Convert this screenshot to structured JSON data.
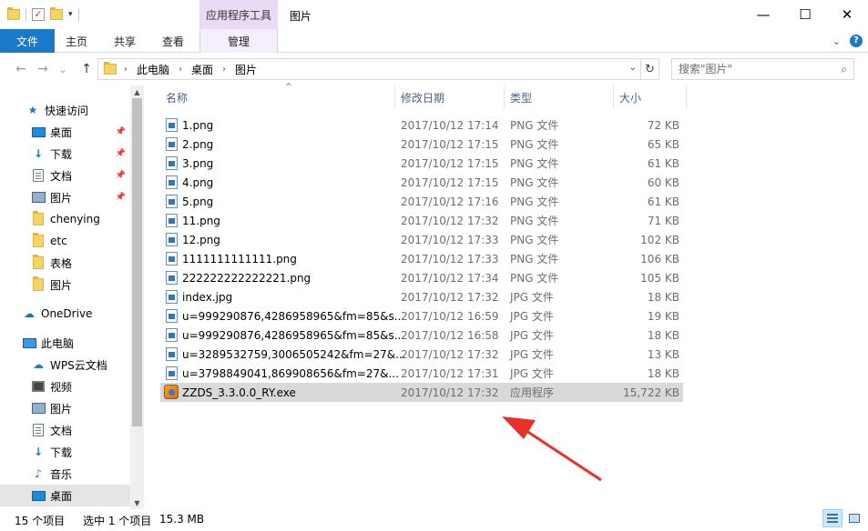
{
  "window": {
    "title": "图片",
    "context_tab_group": "应用程序工具",
    "minimize": "—",
    "maximize": "☐",
    "close": "✕"
  },
  "ribbon": {
    "tabs": [
      "文件",
      "主页",
      "共享",
      "查看",
      "管理"
    ],
    "help": "?"
  },
  "nav": {
    "back": "←",
    "forward": "→",
    "recent": "⌄",
    "up": "↑",
    "breadcrumbs": [
      "此电脑",
      "桌面",
      "图片"
    ],
    "search_placeholder": "搜索\"图片\""
  },
  "sidebar": {
    "items": [
      {
        "label": "快速访问",
        "icon": "star-icon"
      },
      {
        "label": "桌面",
        "icon": "desktop-icon",
        "pinned": true
      },
      {
        "label": "下载",
        "icon": "download-icon",
        "pinned": true
      },
      {
        "label": "文档",
        "icon": "document-icon",
        "pinned": true
      },
      {
        "label": "图片",
        "icon": "pictures-icon",
        "pinned": true
      },
      {
        "label": "chenying",
        "icon": "folder-icon"
      },
      {
        "label": "etc",
        "icon": "folder-icon"
      },
      {
        "label": "表格",
        "icon": "folder-icon"
      },
      {
        "label": "图片",
        "icon": "folder-icon"
      },
      {
        "label": "OneDrive",
        "icon": "cloud-icon"
      },
      {
        "label": "此电脑",
        "icon": "computer-icon"
      },
      {
        "label": "WPS云文档",
        "icon": "wps-cloud-icon"
      },
      {
        "label": "视频",
        "icon": "video-icon"
      },
      {
        "label": "图片",
        "icon": "pictures-icon"
      },
      {
        "label": "文档",
        "icon": "document-icon"
      },
      {
        "label": "下载",
        "icon": "download-icon"
      },
      {
        "label": "音乐",
        "icon": "music-icon"
      },
      {
        "label": "桌面",
        "icon": "desktop-icon",
        "selected": true
      }
    ]
  },
  "columns": {
    "name": "名称",
    "date": "修改日期",
    "type": "类型",
    "size": "大小"
  },
  "files": [
    {
      "name": "1.png",
      "date": "2017/10/12 17:14",
      "type": "PNG 文件",
      "size": "72 KB"
    },
    {
      "name": "2.png",
      "date": "2017/10/12 17:15",
      "type": "PNG 文件",
      "size": "65 KB"
    },
    {
      "name": "3.png",
      "date": "2017/10/12 17:15",
      "type": "PNG 文件",
      "size": "61 KB"
    },
    {
      "name": "4.png",
      "date": "2017/10/12 17:15",
      "type": "PNG 文件",
      "size": "60 KB"
    },
    {
      "name": "5.png",
      "date": "2017/10/12 17:16",
      "type": "PNG 文件",
      "size": "61 KB"
    },
    {
      "name": "11.png",
      "date": "2017/10/12 17:32",
      "type": "PNG 文件",
      "size": "71 KB"
    },
    {
      "name": "12.png",
      "date": "2017/10/12 17:33",
      "type": "PNG 文件",
      "size": "102 KB"
    },
    {
      "name": "1111111111111.png",
      "date": "2017/10/12 17:33",
      "type": "PNG 文件",
      "size": "106 KB"
    },
    {
      "name": "222222222222221.png",
      "date": "2017/10/12 17:34",
      "type": "PNG 文件",
      "size": "105 KB"
    },
    {
      "name": "index.jpg",
      "date": "2017/10/12 17:32",
      "type": "JPG 文件",
      "size": "18 KB"
    },
    {
      "name": "u=999290876,4286958965&fm=85&s...",
      "date": "2017/10/12 16:59",
      "type": "JPG 文件",
      "size": "19 KB"
    },
    {
      "name": "u=999290876,4286958965&fm=85&s...",
      "date": "2017/10/12 16:58",
      "type": "JPG 文件",
      "size": "18 KB"
    },
    {
      "name": "u=3289532759,3006505242&fm=27&...",
      "date": "2017/10/12 17:32",
      "type": "JPG 文件",
      "size": "13 KB"
    },
    {
      "name": "u=3798849041,869908656&fm=27&...",
      "date": "2017/10/12 17:31",
      "type": "JPG 文件",
      "size": "18 KB"
    },
    {
      "name": "ZZDS_3.3.0.0_RY.exe",
      "date": "2017/10/12 17:32",
      "type": "应用程序",
      "size": "15,722 KB",
      "selected": true
    }
  ],
  "status": {
    "count": "15 个项目",
    "selection": "选中 1 个项目",
    "selected_size": "15.3 MB"
  },
  "colors": {
    "file_tab": "#1979ca",
    "context_tab": "#eadbf5",
    "selection": "#d9d9d9",
    "annotation_arrow": "#e8312a"
  }
}
